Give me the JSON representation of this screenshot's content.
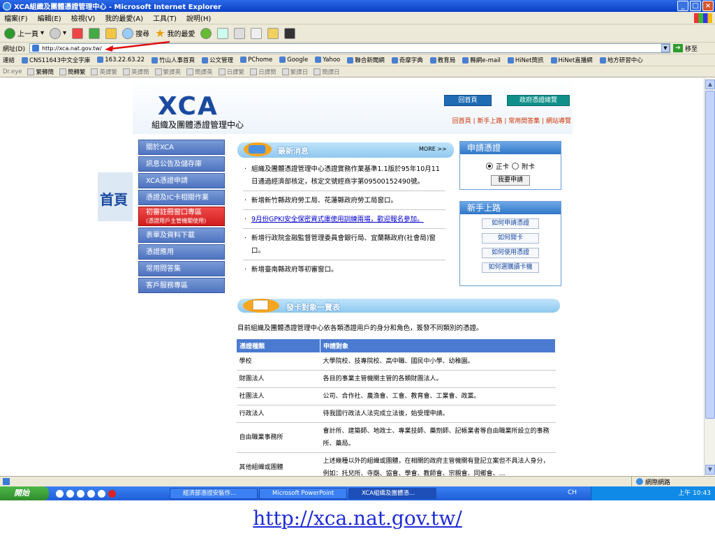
{
  "window": {
    "title": "XCA組織及團體憑證管理中心 - Microsoft Internet Explorer",
    "buttons": [
      "_",
      "□",
      "×"
    ]
  },
  "menu": [
    "檔案(F)",
    "編輯(E)",
    "檢視(V)",
    "我的最愛(A)",
    "工具(T)",
    "說明(H)"
  ],
  "toolbar": {
    "back": "上一頁",
    "search": "搜尋",
    "favorites": "我的最愛"
  },
  "address": {
    "label": "網址(D)",
    "url": "http://xca.nat.gov.tw/",
    "go": "移至"
  },
  "links": {
    "label": "連結",
    "items": [
      "CNS11643中文全字庫",
      "163.22.63.22",
      "竹山人事首頁",
      "公文管理",
      "PChome",
      "Google",
      "Yahoo",
      "聯合新聞網",
      "奇摩字典",
      "教育局",
      "縣網e-mail",
      "HiNet簡訊",
      "HiNet直播網",
      "地方研習中心"
    ]
  },
  "dreye": {
    "label": "Dr.eye",
    "items": [
      "繁轉簡",
      "簡轉繁",
      "英譯繁",
      "英譯簡",
      "繁譯英",
      "簡譯英",
      "日譯繁",
      "日譯簡",
      "繁譯日",
      "簡譯日"
    ]
  },
  "site": {
    "logo": "XCA",
    "logo_sub": "組織及團體憑證管理中心",
    "header_buttons": [
      "回首頁",
      "政府憑證總覽"
    ],
    "header_links": "回首頁 | 新手上路 | 常用問答集 | 網站導覽",
    "home_label": "首頁"
  },
  "nav": [
    {
      "label": "關於XCA"
    },
    {
      "label": "訊息公告及儲存庫"
    },
    {
      "label": "XCA憑證申請"
    },
    {
      "label": "憑證及IC卡相關作業"
    },
    {
      "label": "初審註冊窗口專區",
      "sub": "(憑證用戶主管機關使用)"
    },
    {
      "label": "表單及資料下載"
    },
    {
      "label": "憑證應用"
    },
    {
      "label": "常用問答集"
    },
    {
      "label": "客戶服務專區"
    }
  ],
  "news": {
    "title": "最新消息",
    "more": "MORE >>",
    "items": [
      {
        "text": "組織及團體憑證管理中心憑證實務作業基準1.1版於95年10月11日通過經濟部核定，核定文號經商字第09500152490號。"
      },
      {
        "text": "新增新竹縣政府勞工局、花蓮縣政府勞工局窗口。"
      },
      {
        "text": "9月份GPKI安全保密資式庫使用訓練兩場，歡迎報名參加。"
      },
      {
        "text": "新增行政院金融監督管理委員會銀行局、宜蘭縣政府(社會局)窗口。"
      },
      {
        "text": "新增臺南縣政府等初審窗口。"
      }
    ]
  },
  "apply_box": {
    "title": "申請憑證",
    "options": [
      "正卡",
      "附卡"
    ],
    "button": "我要申請"
  },
  "guide_box": {
    "title": "新手上路",
    "buttons": [
      "如何申請憑證",
      "如何開卡",
      "如何使用憑證",
      "如何選購讀卡機"
    ]
  },
  "cards": {
    "title": "發卡對象一覽表",
    "intro": "目前組織及團體憑證管理中心依各類憑證用戶的身分和角色，簽發不同類別的憑證。",
    "headers": [
      "憑證種類",
      "申請對象"
    ],
    "rows": [
      [
        "學校",
        "大學院校、技專院校、高中職、國民中小學、幼稚園。"
      ],
      [
        "財團法人",
        "各目的事業主管機關主管的各類財團法人。"
      ],
      [
        "社團法人",
        "公司、合作社、農漁會、工會、教育會、工業會、政黨。"
      ],
      [
        "行政法人",
        "待我國行政法人法完成立法後，始受理申請。"
      ],
      [
        "自由職業事務所",
        "會計所、建築師、地政士、專業技師、藥劑師、記帳業者等自由職業所設立的事務所、藥局。"
      ],
      [
        "其他組織或團體",
        "上述幾種以外的組織或團體，在相關的政府主管機關有登記立案但不具法人身分，例如：托兒所、寺廟、協會、學會、教師會、宗親會、同鄉會、…"
      ]
    ]
  },
  "status": {
    "zone": "網際網路"
  },
  "taskbar": {
    "start": "開始",
    "tasks": [
      "經濟部憑證安裝作...",
      "Microsoft PowerPoint",
      "XCA組織及團體憑..."
    ],
    "lang": "CH",
    "clock": "上午 10:43"
  },
  "caption": "http://xca.nat.gov.tw/"
}
